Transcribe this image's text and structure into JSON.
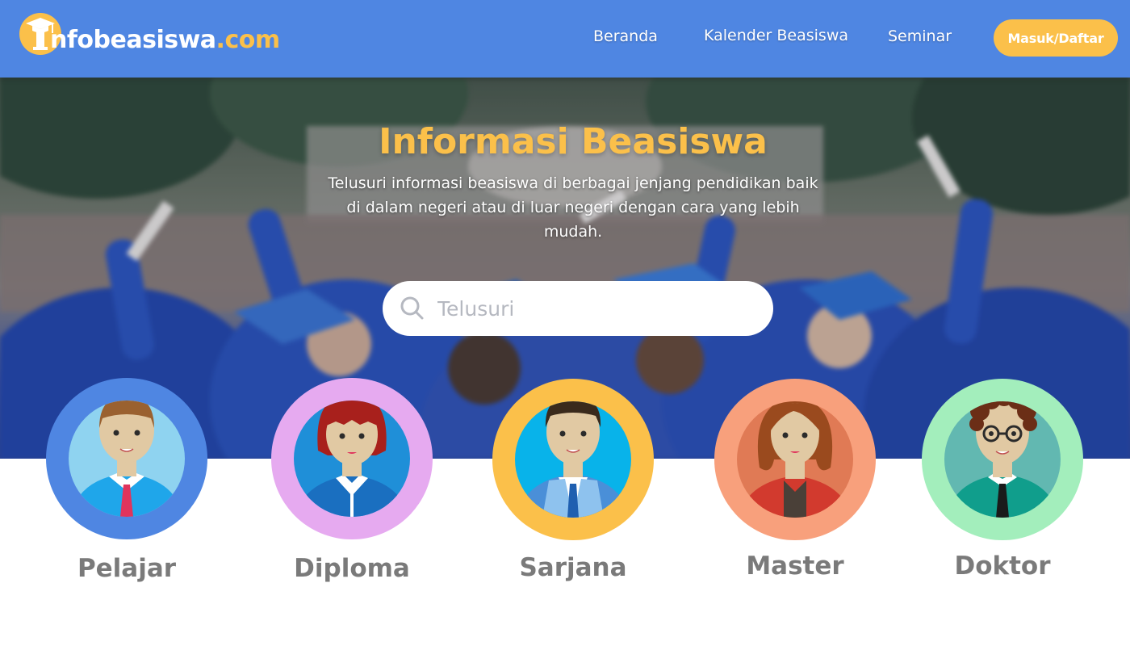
{
  "header": {
    "logo_main": "nfobeasiswa",
    "logo_tld": ".com",
    "nav": [
      "Beranda",
      "Kalender Beasiswa",
      "Seminar"
    ],
    "login_label": "Masuk/Daftar"
  },
  "hero": {
    "title": "Informasi Beasiswa",
    "subtitle": "Telusuri informasi beasiswa di berbagai jenjang pendidikan baik di dalam negeri atau di luar negeri  dengan cara yang lebih mudah."
  },
  "search": {
    "placeholder": "Telusuri"
  },
  "levels": [
    {
      "label": "Pelajar",
      "ring_color": "#4f86e2",
      "inner_color": "#8fd3f0"
    },
    {
      "label": "Diploma",
      "ring_color": "#e6aaf0",
      "inner_color": "#1f8fd8"
    },
    {
      "label": "Sarjana",
      "ring_color": "#fbc04a",
      "inner_color": "#08b3ea"
    },
    {
      "label": "Master",
      "ring_color": "#f8a07c",
      "inner_color": "#e07a55"
    },
    {
      "label": "Doktor",
      "ring_color": "#a3eebc",
      "inner_color": "#62b8b1"
    }
  ],
  "colors": {
    "header_bg": "#4f86e2",
    "accent": "#fbc04a",
    "label_gray": "#7a7a7a"
  }
}
